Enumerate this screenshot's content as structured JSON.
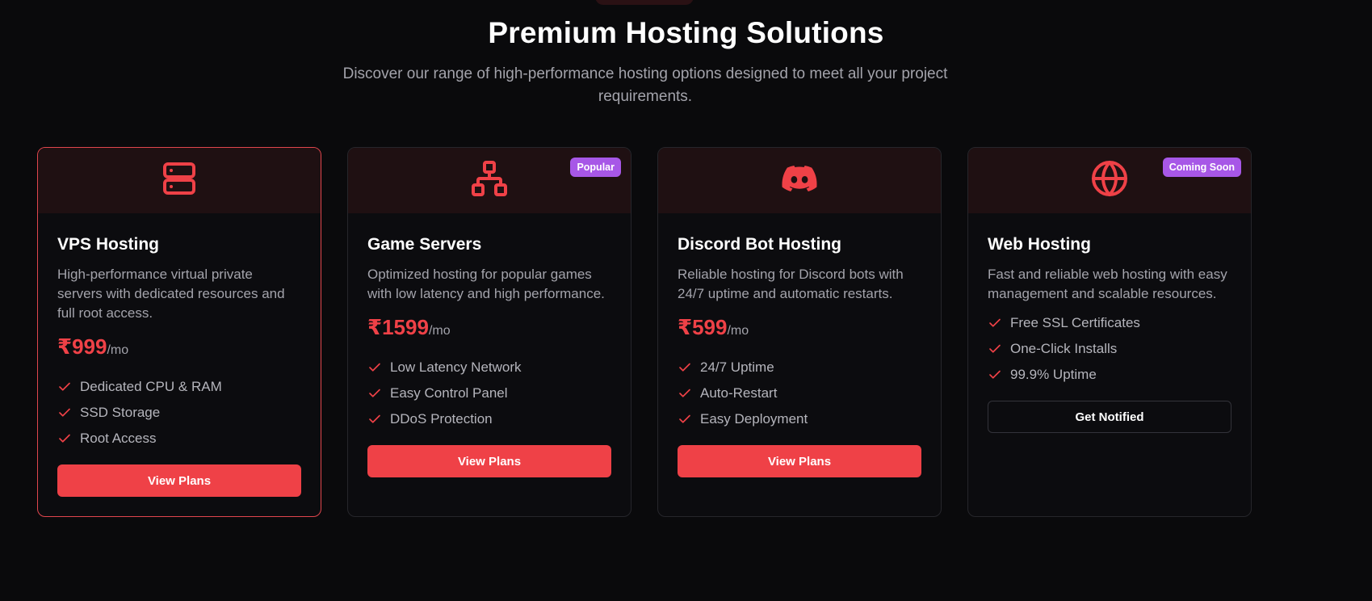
{
  "header": {
    "title": "Premium Hosting Solutions",
    "subtitle": "Discover our range of high-performance hosting options designed to meet all your project requirements."
  },
  "colors": {
    "accent": "#ef4147",
    "badge": "#a757e7",
    "background": "#0a0a0c",
    "card_head": "#1f1012"
  },
  "cards": [
    {
      "icon": "server-icon",
      "title": "VPS Hosting",
      "description": "High-performance virtual private servers with dedicated resources and full root access.",
      "price": "₹999",
      "period": "/mo",
      "features": [
        "Dedicated CPU & RAM",
        "SSD Storage",
        "Root Access"
      ],
      "button": "View Plans"
    },
    {
      "icon": "network-icon",
      "badge": "Popular",
      "title": "Game Servers",
      "description": "Optimized hosting for popular games with low latency and high performance.",
      "price": "₹1599",
      "period": "/mo",
      "features": [
        "Low Latency Network",
        "Easy Control Panel",
        "DDoS Protection"
      ],
      "button": "View Plans"
    },
    {
      "icon": "discord-icon",
      "title": "Discord Bot Hosting",
      "description": "Reliable hosting for Discord bots with 24/7 uptime and automatic restarts.",
      "price": "₹599",
      "period": "/mo",
      "features": [
        "24/7 Uptime",
        "Auto-Restart",
        "Easy Deployment"
      ],
      "button": "View Plans"
    },
    {
      "icon": "globe-icon",
      "badge": "Coming Soon",
      "title": "Web Hosting",
      "description": "Fast and reliable web hosting with easy management and scalable resources.",
      "features": [
        "Free SSL Certificates",
        "One-Click Installs",
        "99.9% Uptime"
      ],
      "button": "Get Notified"
    }
  ]
}
